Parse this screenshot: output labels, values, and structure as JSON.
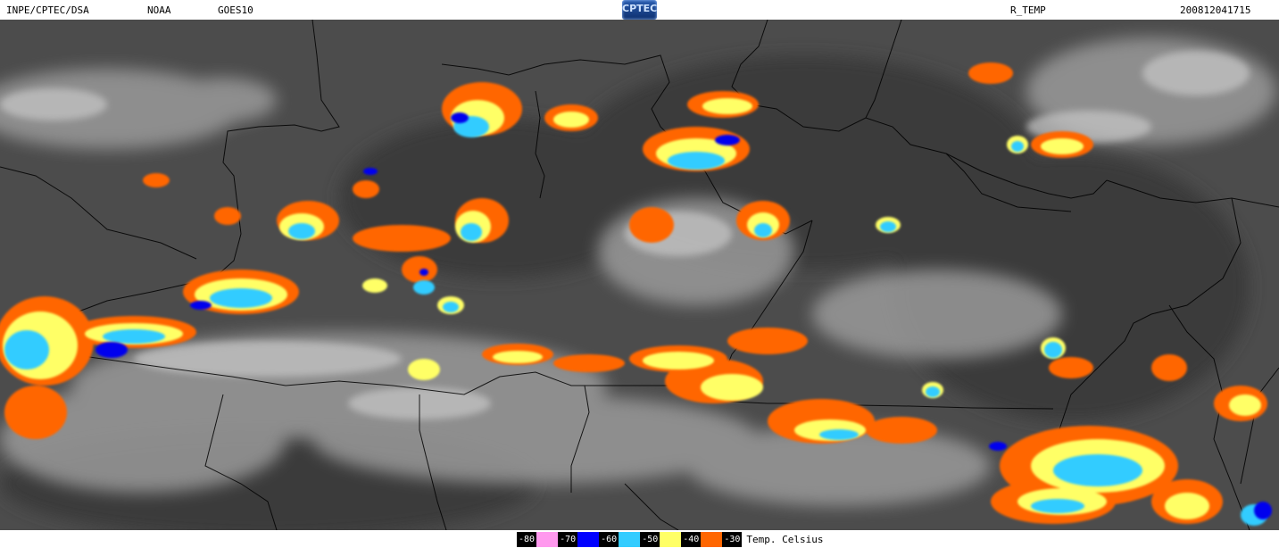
{
  "header": {
    "source": "INPE/CPTEC/DSA",
    "agency": "NOAA",
    "satellite": "GOES10",
    "logo_text": "CPTEC",
    "product": "R_TEMP",
    "timestamp": "200812041715"
  },
  "legend": {
    "unit": "Temp. Celsius",
    "items": [
      {
        "value": "-80",
        "color": "#ff99ee"
      },
      {
        "value": "-70",
        "color": "#0000ff"
      },
      {
        "value": "-60",
        "color": "#33ccff"
      },
      {
        "value": "-50",
        "color": "#ffff66"
      },
      {
        "value": "-40",
        "color": "#ff6600"
      },
      {
        "value": "-30",
        "color": ""
      }
    ]
  },
  "map": {
    "description_colors": {
      "background": "#555555",
      "cloud": "#cccccc",
      "border": "#000000"
    }
  }
}
